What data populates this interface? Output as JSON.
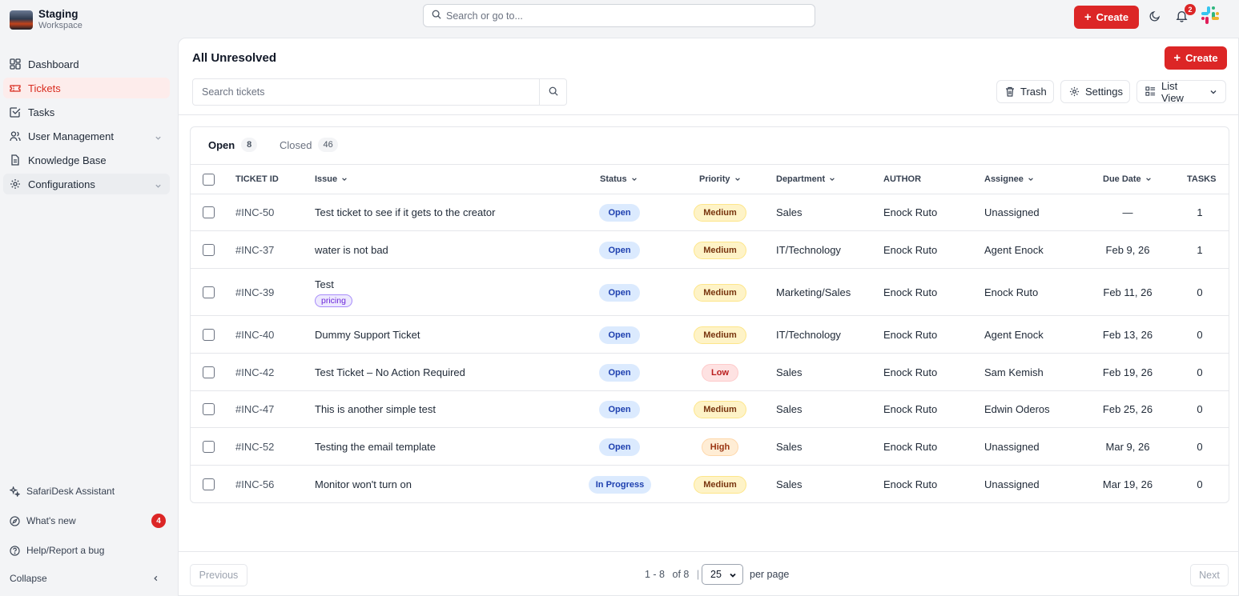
{
  "workspace": {
    "name": "Staging",
    "subtitle": "Workspace"
  },
  "sidebar": {
    "items": [
      {
        "label": "Dashboard",
        "icon": "dashboard-icon",
        "active": false
      },
      {
        "label": "Tickets",
        "icon": "ticket-icon",
        "active": true
      },
      {
        "label": "Tasks",
        "icon": "tasks-icon",
        "active": false
      },
      {
        "label": "User Management",
        "icon": "users-icon",
        "active": false,
        "expandable": true
      },
      {
        "label": "Knowledge Base",
        "icon": "document-icon",
        "active": false
      },
      {
        "label": "Configurations",
        "icon": "gear-icon",
        "active": false,
        "expandable": true
      }
    ],
    "bottom": [
      {
        "label": "SafariDesk Assistant",
        "icon": "sparkle-icon"
      },
      {
        "label": "What's new",
        "icon": "compass-icon",
        "badge": "4"
      },
      {
        "label": "Help/Report a bug",
        "icon": "help-icon"
      }
    ],
    "collapse_label": "Collapse"
  },
  "topbar": {
    "search_placeholder": "Search or go to...",
    "create_label": "Create",
    "notification_count": "2"
  },
  "main": {
    "title": "All Unresolved",
    "create_label": "Create",
    "search_placeholder": "Search tickets",
    "trash_label": "Trash",
    "settings_label": "Settings",
    "view_label": "List View",
    "tabs": [
      {
        "label": "Open",
        "count": "8",
        "active": true
      },
      {
        "label": "Closed",
        "count": "46",
        "active": false
      }
    ],
    "columns": [
      "TICKET ID",
      "Issue",
      "Status",
      "Priority",
      "Department",
      "AUTHOR",
      "Assignee",
      "Due Date",
      "TASKS"
    ],
    "rows": [
      {
        "id": "#INC-50",
        "issue": "Test ticket to see if it gets to the creator",
        "tag": "",
        "status": "Open",
        "priority": "Medium",
        "department": "Sales",
        "author": "Enock Ruto",
        "assignee": "Unassigned",
        "due": "—",
        "tasks": "1"
      },
      {
        "id": "#INC-37",
        "issue": "water is not bad",
        "tag": "",
        "status": "Open",
        "priority": "Medium",
        "department": "IT/Technology",
        "author": "Enock Ruto",
        "assignee": "Agent Enock",
        "due": "Feb 9, 26",
        "tasks": "1"
      },
      {
        "id": "#INC-39",
        "issue": "Test",
        "tag": "pricing",
        "status": "Open",
        "priority": "Medium",
        "department": "Marketing/Sales",
        "author": "Enock Ruto",
        "assignee": "Enock Ruto",
        "due": "Feb 11, 26",
        "tasks": "0"
      },
      {
        "id": "#INC-40",
        "issue": "Dummy Support Ticket",
        "tag": "",
        "status": "Open",
        "priority": "Medium",
        "department": "IT/Technology",
        "author": "Enock Ruto",
        "assignee": "Agent Enock",
        "due": "Feb 13, 26",
        "tasks": "0"
      },
      {
        "id": "#INC-42",
        "issue": "Test Ticket – No Action Required",
        "tag": "",
        "status": "Open",
        "priority": "Low",
        "department": "Sales",
        "author": "Enock Ruto",
        "assignee": "Sam Kemish",
        "due": "Feb 19, 26",
        "tasks": "0"
      },
      {
        "id": "#INC-47",
        "issue": "This is another simple test",
        "tag": "",
        "status": "Open",
        "priority": "Medium",
        "department": "Sales",
        "author": "Enock Ruto",
        "assignee": "Edwin Oderos",
        "due": "Feb 25, 26",
        "tasks": "0"
      },
      {
        "id": "#INC-52",
        "issue": "Testing the email template",
        "tag": "",
        "status": "Open",
        "priority": "High",
        "department": "Sales",
        "author": "Enock Ruto",
        "assignee": "Unassigned",
        "due": "Mar 9, 26",
        "tasks": "0"
      },
      {
        "id": "#INC-56",
        "issue": "Monitor won't turn on",
        "tag": "",
        "status": "In Progress",
        "priority": "Medium",
        "department": "Sales",
        "author": "Enock Ruto",
        "assignee": "Unassigned",
        "due": "Mar 19, 26",
        "tasks": "0"
      }
    ]
  },
  "pagination": {
    "previous_label": "Previous",
    "next_label": "Next",
    "range": "1 - 8",
    "of": "of 8",
    "page_size": "25",
    "per_page_label": "per page"
  },
  "colors": {
    "accent": "#dc2626",
    "active_bg": "#fdeceb"
  }
}
